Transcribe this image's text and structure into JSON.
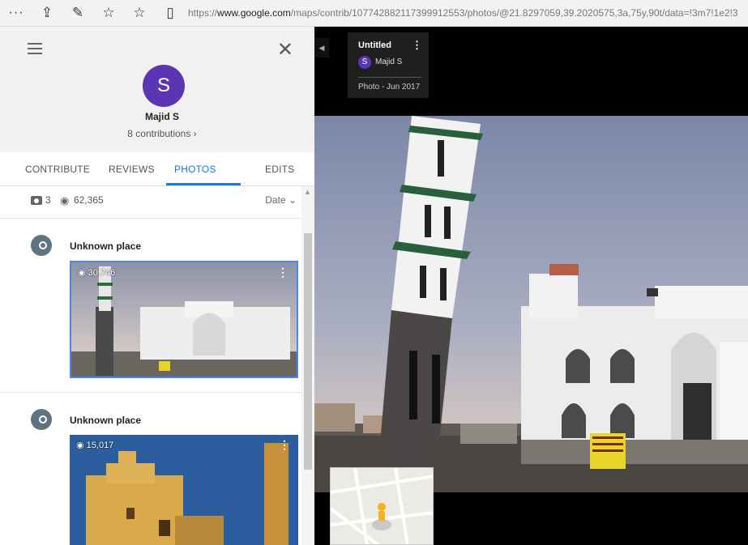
{
  "browser": {
    "dots": "···",
    "url_prefix": "https://",
    "url_host": "www.google.com",
    "url_path": "/maps/contrib/107742882117399912553/photos/@21.8297059,39.2020575,3a,75y,90t/data=!3m7!1e2!3"
  },
  "profile": {
    "avatar_letter": "S",
    "name": "Majid S",
    "contributions": "8 contributions ›"
  },
  "tabs": [
    {
      "label": "CONTRIBUTE"
    },
    {
      "label": "REVIEWS"
    },
    {
      "label": "PHOTOS"
    },
    {
      "label": "EDITS"
    }
  ],
  "stats": {
    "photo_count": "3",
    "views": "62,365",
    "sort_label": "Date ⌄"
  },
  "photos": [
    {
      "place": "Unknown place",
      "views": "30,746"
    },
    {
      "place": "Unknown place",
      "views": "15,017"
    }
  ],
  "viewer": {
    "title": "Untitled",
    "avatar_letter": "S",
    "user": "Majid S",
    "date": "Photo - Jun 2017"
  },
  "colors": {
    "accent": "#1a73e8",
    "avatar": "#5c35b3"
  }
}
